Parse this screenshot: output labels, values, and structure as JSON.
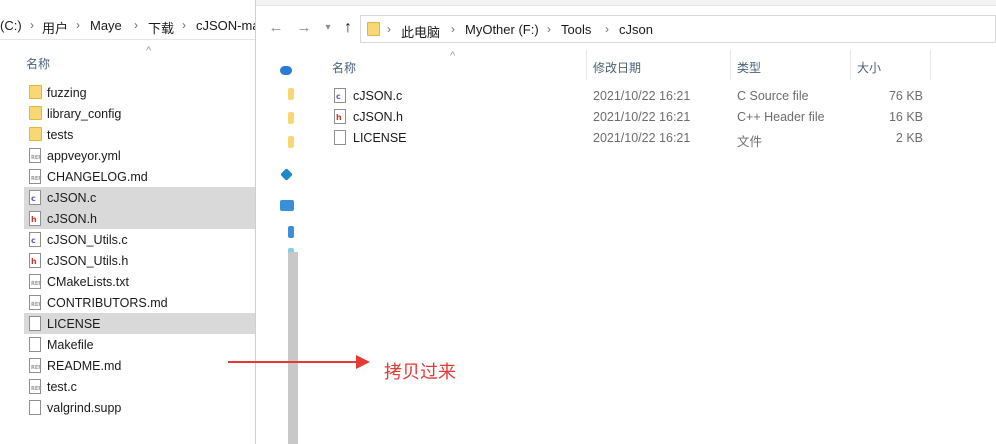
{
  "left_window": {
    "breadcrumb": [
      "(C:)",
      "用户",
      "Maye",
      "下载",
      "cJSON-ma"
    ],
    "column_name": "名称",
    "files": [
      {
        "name": "fuzzing",
        "icon": "folder-icon",
        "selected": false
      },
      {
        "name": "library_config",
        "icon": "folder-icon",
        "selected": false
      },
      {
        "name": "tests",
        "icon": "folder-icon",
        "selected": false
      },
      {
        "name": "appveyor.yml",
        "icon": "generic-file-icon",
        "selected": false
      },
      {
        "name": "CHANGELOG.md",
        "icon": "generic-file-icon",
        "selected": false
      },
      {
        "name": "cJSON.c",
        "icon": "c-source-icon",
        "selected": true
      },
      {
        "name": "cJSON.h",
        "icon": "c-header-icon",
        "selected": true
      },
      {
        "name": "cJSON_Utils.c",
        "icon": "c-source-icon",
        "selected": false
      },
      {
        "name": "cJSON_Utils.h",
        "icon": "c-header-icon",
        "selected": false
      },
      {
        "name": "CMakeLists.txt",
        "icon": "generic-file-icon",
        "selected": false
      },
      {
        "name": "CONTRIBUTORS.md",
        "icon": "generic-file-icon",
        "selected": false
      },
      {
        "name": "LICENSE",
        "icon": "blank-file-icon",
        "selected": true
      },
      {
        "name": "Makefile",
        "icon": "blank-file-icon",
        "selected": false
      },
      {
        "name": "README.md",
        "icon": "generic-file-icon",
        "selected": false
      },
      {
        "name": "test.c",
        "icon": "generic-file-icon",
        "selected": false
      },
      {
        "name": "valgrind.supp",
        "icon": "blank-file-icon",
        "selected": false
      }
    ]
  },
  "right_window": {
    "breadcrumb": [
      "此电脑",
      "MyOther (F:)",
      "Tools",
      "cJson"
    ],
    "columns": {
      "name": "名称",
      "modified": "修改日期",
      "type": "类型",
      "size": "大小"
    },
    "files": [
      {
        "name": "cJSON.c",
        "modified": "2021/10/22 16:21",
        "type": "C Source file",
        "size": "76 KB",
        "icon": "c-source-icon"
      },
      {
        "name": "cJSON.h",
        "modified": "2021/10/22 16:21",
        "type": "C++ Header file",
        "size": "16 KB",
        "icon": "c-header-icon"
      },
      {
        "name": "LICENSE",
        "modified": "2021/10/22 16:21",
        "type": "文件",
        "size": "2 KB",
        "icon": "blank-file-icon"
      }
    ]
  },
  "annotation": {
    "note": "拷贝过来",
    "color": "#e53935"
  },
  "colors": {
    "selection": "#d9d9d9",
    "folder": "#f8d775",
    "header_text": "#4c607a"
  }
}
